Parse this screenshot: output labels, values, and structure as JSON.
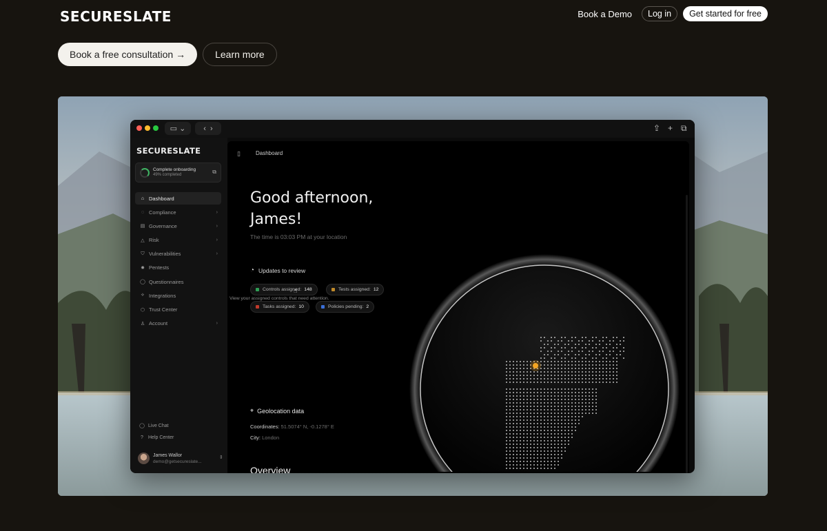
{
  "brand": {
    "logo": "SECURESLATE"
  },
  "nav": {
    "demo": "Book a Demo",
    "login": "Log in",
    "get_started": "Get started for free"
  },
  "cta": {
    "primary": "Book a free consultation →",
    "secondary": "Learn more"
  },
  "app": {
    "logo": "SECURESLATE",
    "onboarding": {
      "title": "Complete onboarding",
      "progress": "49% completed",
      "progress_value": 0.49
    },
    "nav_items": [
      {
        "label": "Dashboard",
        "icon": "home-icon",
        "glyph": "⌂",
        "chevron": false,
        "active": true
      },
      {
        "label": "Compliance",
        "icon": "compliance-icon",
        "glyph": "◌",
        "chevron": true,
        "active": false
      },
      {
        "label": "Governance",
        "icon": "governance-icon",
        "glyph": "▤",
        "chevron": true,
        "active": false
      },
      {
        "label": "Risk",
        "icon": "risk-icon",
        "glyph": "△",
        "chevron": true,
        "active": false
      },
      {
        "label": "Vulnerabilities",
        "icon": "vulnerabilities-icon",
        "glyph": "⛉",
        "chevron": true,
        "active": false
      },
      {
        "label": "Pentests",
        "icon": "pentests-icon",
        "glyph": "✹",
        "chevron": false,
        "active": false
      },
      {
        "label": "Questionnaires",
        "icon": "questionnaires-icon",
        "glyph": "◯",
        "chevron": false,
        "active": false
      },
      {
        "label": "Integrations",
        "icon": "integrations-icon",
        "glyph": "⟡",
        "chevron": false,
        "active": false
      },
      {
        "label": "Trust Center",
        "icon": "trust-center-icon",
        "glyph": "⬡",
        "chevron": false,
        "active": false
      },
      {
        "label": "Account",
        "icon": "account-icon",
        "glyph": "♙",
        "chevron": true,
        "active": false
      }
    ],
    "live_chat": "Live Chat",
    "help_center": "Help Center",
    "user": {
      "name": "James Wallor",
      "email": "demo@getsecureslate..."
    },
    "breadcrumb": "Dashboard",
    "greeting": "Good afternoon, James!",
    "time_line": "The time is 03:03 PM at your location",
    "updates": {
      "title": "Updates to review",
      "pills": [
        {
          "label": "Controls assigned:",
          "count": "148",
          "color": "#2f9e55"
        },
        {
          "label": "Tests assigned:",
          "count": "12",
          "color": "#c08a2a"
        },
        {
          "label": "Tasks assigned:",
          "count": "10",
          "color": "#c0392b"
        },
        {
          "label": "Policies pending:",
          "count": "2",
          "color": "#3a6fd8"
        }
      ],
      "tooltip": "View your assigned controls that need attention."
    },
    "geo": {
      "title": "Geolocation data",
      "coordinates_label": "Coordinates:",
      "coordinates_value": "51.5074° N, -0.1278° E",
      "city_label": "City:",
      "city_value": "London"
    },
    "overview": "Overview"
  }
}
